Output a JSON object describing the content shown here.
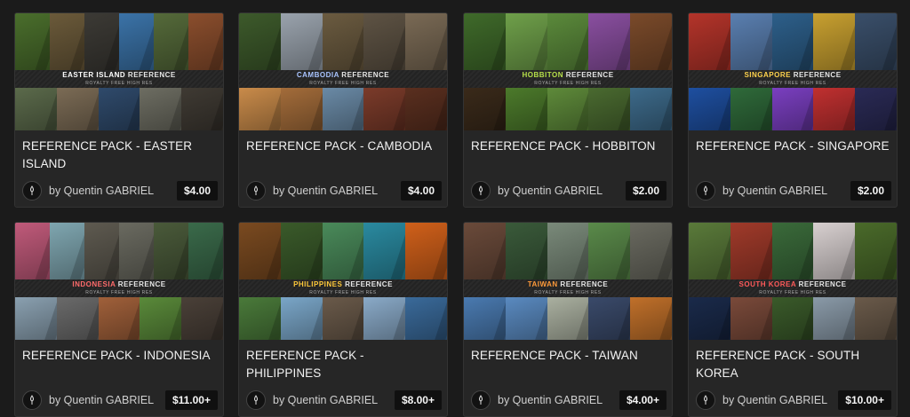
{
  "shared": {
    "author": "by Quentin GABRIEL",
    "subtitle": "ROYALTY FREE HIGH RES"
  },
  "cards": [
    {
      "title": "REFERENCE PACK - EASTER ISLAND",
      "band_accent": "EASTER ISLAND",
      "band_rest": " REFERENCE",
      "accent_color": "#ffffff",
      "price": "$4.00",
      "top": [
        "#4a6e2c",
        "#6b5a3a",
        "#3c3a35",
        "#3b73a8",
        "#556a3a",
        "#8b4e2d"
      ],
      "bottom": [
        "#5b6a4b",
        "#7b6b55",
        "#2f4a6b",
        "#6d6d62",
        "#3f3a33"
      ]
    },
    {
      "title": "REFERENCE PACK - CAMBODIA",
      "band_accent": "CAMBODIA",
      "band_rest": " REFERENCE",
      "accent_color": "#a9c4ff",
      "price": "$4.00",
      "top": [
        "#3d5a2b",
        "#9aa3ad",
        "#6b5b40",
        "#5e5344",
        "#7a6a55"
      ],
      "bottom": [
        "#c98b4a",
        "#a36c3a",
        "#6a8aa6",
        "#7b3b2a",
        "#5a2f1f"
      ]
    },
    {
      "title": "REFERENCE PACK - HOBBITON",
      "band_accent": "HOBBITON",
      "band_rest": " REFERENCE",
      "accent_color": "#b7e04a",
      "price": "$2.00",
      "top": [
        "#3f6a2a",
        "#6fa04a",
        "#5b8a3b",
        "#8a4fa0",
        "#7a4a2a"
      ],
      "bottom": [
        "#3a2a1a",
        "#4c7a2b",
        "#5e8a3a",
        "#4a6a30",
        "#3d6a8a"
      ]
    },
    {
      "title": "REFERENCE PACK - SINGAPORE",
      "band_accent": "SINGAPORE",
      "band_rest": " REFERENCE",
      "accent_color": "#ffd34d",
      "price": "$2.00",
      "top": [
        "#b4342a",
        "#5a7fb0",
        "#2d5f8a",
        "#c8a030",
        "#3a4f6a"
      ],
      "bottom": [
        "#1e4fa0",
        "#2f6a3a",
        "#7a3fc0",
        "#c03030",
        "#2a2a55"
      ]
    },
    {
      "title": "REFERENCE PACK - INDONESIA",
      "band_accent": "INDONESIA",
      "band_rest": " REFERENCE",
      "accent_color": "#ff6b6b",
      "price": "$11.00+",
      "top": [
        "#c05a7a",
        "#7fa6b0",
        "#5e5a50",
        "#6a6a60",
        "#4a5a3a",
        "#3a6a4a"
      ],
      "bottom": [
        "#8aa0b0",
        "#6a6a6a",
        "#a0603a",
        "#5a8a3a",
        "#4a4038"
      ]
    },
    {
      "title": "REFERENCE PACK - PHILIPPINES",
      "band_accent": "PHILIPPINES",
      "band_rest": " REFERENCE",
      "accent_color": "#ffc93a",
      "price": "$8.00+",
      "top": [
        "#7a4a20",
        "#3a5a2a",
        "#4a8a5a",
        "#2a8aa0",
        "#d0601a"
      ],
      "bottom": [
        "#4a7a3a",
        "#7aa6c8",
        "#6a5a4a",
        "#8aaac8",
        "#3a6a9a"
      ]
    },
    {
      "title": "REFERENCE PACK - TAIWAN",
      "band_accent": "TAIWAN",
      "band_rest": " REFERENCE",
      "accent_color": "#ff9a3a",
      "price": "$4.00+",
      "top": [
        "#6a4a3a",
        "#3a5a3a",
        "#7a8a7a",
        "#5a8a4a",
        "#6a6a60"
      ],
      "bottom": [
        "#4a7ab0",
        "#5a8ac0",
        "#aab0a0",
        "#3a4a6a",
        "#c0702a"
      ]
    },
    {
      "title": "REFERENCE PACK - SOUTH KOREA",
      "band_accent": "SOUTH KOREA",
      "band_rest": " REFERENCE",
      "accent_color": "#ff5a5a",
      "price": "$10.00+",
      "top": [
        "#5a7a3a",
        "#a03a2a",
        "#3a6a3a",
        "#d8d0d0",
        "#4a6a2a"
      ],
      "bottom": [
        "#1a2a4a",
        "#7a4a3a",
        "#3a5a2a",
        "#8a9aa8",
        "#6a5a4a"
      ]
    }
  ]
}
